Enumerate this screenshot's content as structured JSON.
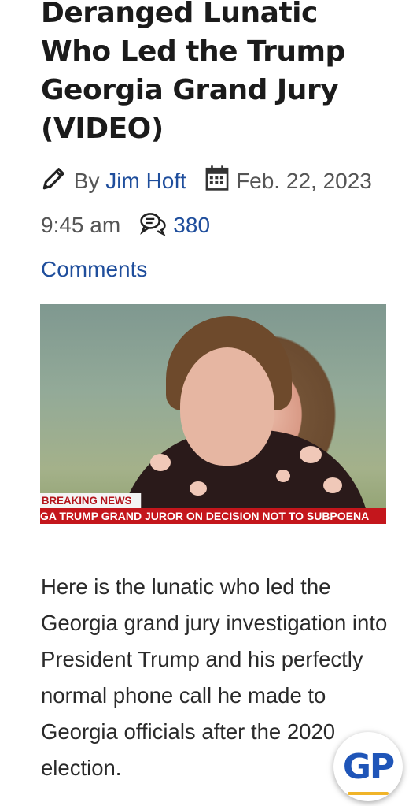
{
  "article": {
    "title_lines": [
      "Deranged Lunatic",
      "Who Led the Trump",
      "Georgia Grand Jury",
      "(VIDEO)"
    ],
    "byline_prefix": "By",
    "author": "Jim Hoft",
    "date_part1": "Feb. 22,",
    "date_part2": "2023 9:45 am",
    "comments_count": "380",
    "comments_label": "Comments",
    "paragraph": "Here is the lunatic who led the Georgia grand jury investigation into President Trump and his perfectly normal phone call he made to Georgia officials after the 2020 election."
  },
  "hero": {
    "breaking_label": "BREAKING NEWS",
    "ticker_text": "GA TRUMP GRAND JUROR ON DECISION NOT TO SUBPOENA"
  },
  "badge": {
    "text": "GP"
  },
  "icons": {
    "author": "pencil-icon",
    "date": "calendar-icon",
    "comments": "comments-icon"
  },
  "colors": {
    "link": "#1f4e9c",
    "breaking_red": "#c4161c",
    "badge_blue": "#1f55b8"
  }
}
